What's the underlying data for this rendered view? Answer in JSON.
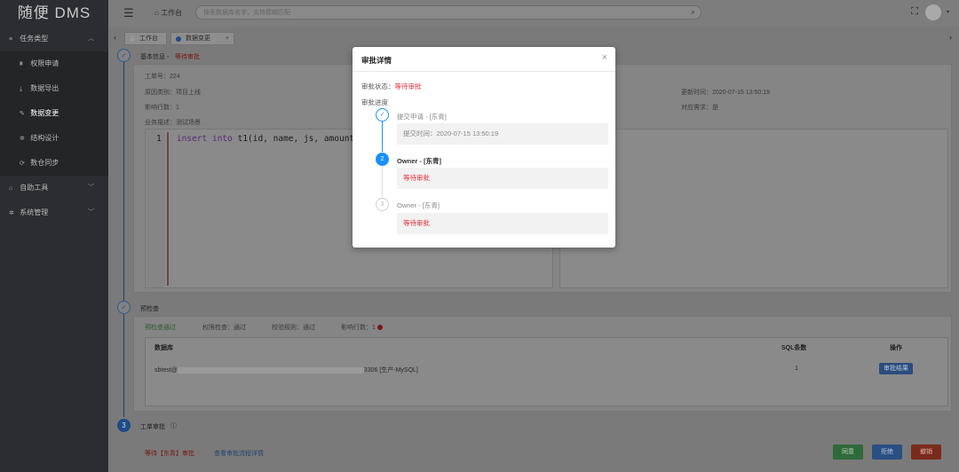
{
  "app": {
    "logo": "随便 DMS"
  },
  "sidebar": {
    "groups": [
      {
        "label": "任务类型",
        "icon": "list-icon",
        "expanded": true
      },
      {
        "label": "自助工具",
        "icon": "home-icon",
        "expanded": false
      },
      {
        "label": "系统管理",
        "icon": "gear-icon",
        "expanded": false
      }
    ],
    "items": [
      {
        "label": "权限申请",
        "icon": "filter-icon"
      },
      {
        "label": "数据导出",
        "icon": "download-icon"
      },
      {
        "label": "数据变更",
        "icon": "edit-icon",
        "active": true
      },
      {
        "label": "结构设计",
        "icon": "gear-icon"
      },
      {
        "label": "数仓同步",
        "icon": "sync-icon"
      }
    ]
  },
  "header": {
    "home_label": "工作台",
    "search_placeholder": "搜索数据库名字，支持模糊匹配"
  },
  "tabs": [
    {
      "label": "工作台",
      "active": false
    },
    {
      "label": "数据变更",
      "active": true
    }
  ],
  "basic_info": {
    "section_label": "基本信息 -",
    "status": "等待审批",
    "ticket_no": "工单号：224",
    "reason": "原因类别：项目上线",
    "affected_rows": "影响行数：1",
    "business_desc": "业务描述：测试场景",
    "update_time": "更新时间：2020-07-15 13:50:19",
    "related_requirement": "对应需求：是"
  },
  "sql": {
    "line_number": "1",
    "keyword_insert": "insert",
    "keyword_into": "into",
    "rest": "t1(id, name, js, amount) v"
  },
  "precheck": {
    "section_label": "预检查",
    "summary": "预检查通过",
    "permission_check": "权限检查：通过",
    "syntax_check": "校验规则：通过",
    "affected_rows_label": "影响行数：",
    "affected_rows_value": "1",
    "table": {
      "headers": [
        "数据库",
        "SQL条数",
        "操作"
      ],
      "row": {
        "db_prefix": "sbtest@",
        "db_suffix": "3306 [生产-MySQL]",
        "sql_count": "1",
        "action": "审批结果"
      }
    }
  },
  "ticket_approval": {
    "step_number": "3",
    "section_label": "工单审批",
    "status_text": "等待【东青】审批",
    "detail_link": "查看审批流程详情",
    "buttons": {
      "approve": "同意",
      "reject": "拒绝",
      "revoke": "撤销"
    }
  },
  "modal": {
    "title": "审批详情",
    "status_label": "审批状态：",
    "status_value": "等待审批",
    "progress_label": "审批进度",
    "steps": [
      {
        "index": "✓",
        "title": "提交申请 - [东青]",
        "desc": "提交时间：2020-07-15 13:50:19",
        "state": "done"
      },
      {
        "index": "2",
        "title": "Owner - [东青]",
        "desc": "等待审批",
        "state": "current"
      },
      {
        "index": "3",
        "title": "Owner - [东青]",
        "desc": "等待审批",
        "state": "wait"
      }
    ]
  },
  "colors": {
    "sidebar_bg": "#2b2d30",
    "accent_blue": "#1890ff",
    "status_red": "#e0303a",
    "approve_green": "#2f6a3a",
    "revoke_red": "#7a2a1c"
  }
}
